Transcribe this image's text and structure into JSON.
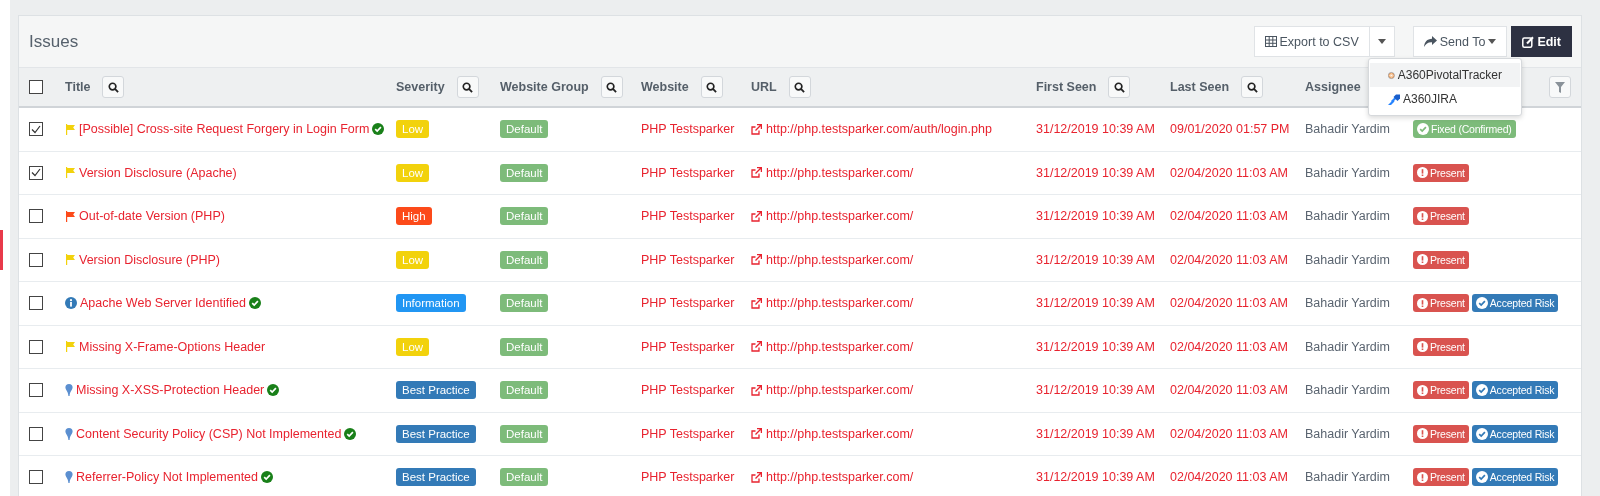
{
  "panel": {
    "title": "Issues"
  },
  "toolbar": {
    "export_label": "Export to CSV",
    "send_label": "Send To",
    "edit_label": "Edit"
  },
  "send_menu": [
    {
      "label": "A360PivotalTracker",
      "kind": "pivotal",
      "selected": true
    },
    {
      "label": "A360JIRA",
      "kind": "jira",
      "selected": false
    }
  ],
  "table": {
    "select_all": {
      "checked": false
    },
    "columns": [
      {
        "label": "Title",
        "searchable": true
      },
      {
        "label": "Severity",
        "searchable": true
      },
      {
        "label": "Website Group",
        "searchable": true
      },
      {
        "label": "Website",
        "searchable": true
      },
      {
        "label": "URL",
        "searchable": true
      },
      {
        "label": "First Seen",
        "searchable": true
      },
      {
        "label": "Last Seen",
        "searchable": true
      },
      {
        "label": "Assignee",
        "searchable": false
      }
    ],
    "rows": [
      {
        "checked": true,
        "kind": "flag",
        "title": "[Possible] Cross-site Request Forgery in Login Form",
        "verified": true,
        "severity": {
          "label": "Low",
          "color": "#f2d20c"
        },
        "group": "Default",
        "website": "PHP Testsparker",
        "url": "http://php.testsparker.com/auth/login.php",
        "first_seen": "31/12/2019 10:39 AM",
        "last_seen": "09/01/2020 01:57 PM",
        "assignee": "Bahadir Yardim",
        "statuses": [
          {
            "label": "Fixed (Confirmed)",
            "kind": "fixed"
          }
        ]
      },
      {
        "checked": true,
        "kind": "flag",
        "title": "Version Disclosure (Apache)",
        "verified": false,
        "severity": {
          "label": "Low",
          "color": "#f2d20c"
        },
        "group": "Default",
        "website": "PHP Testsparker",
        "url": "http://php.testsparker.com/",
        "first_seen": "31/12/2019 10:39 AM",
        "last_seen": "02/04/2020 11:03 AM",
        "assignee": "Bahadir Yardim",
        "statuses": [
          {
            "label": "Present",
            "kind": "present"
          }
        ]
      },
      {
        "checked": false,
        "kind": "flag",
        "title": "Out-of-date Version (PHP)",
        "verified": false,
        "severity": {
          "label": "High",
          "color": "#fc4a1a"
        },
        "group": "Default",
        "website": "PHP Testsparker",
        "url": "http://php.testsparker.com/",
        "first_seen": "31/12/2019 10:39 AM",
        "last_seen": "02/04/2020 11:03 AM",
        "assignee": "Bahadir Yardim",
        "statuses": [
          {
            "label": "Present",
            "kind": "present"
          }
        ]
      },
      {
        "checked": false,
        "kind": "flag",
        "title": "Version Disclosure (PHP)",
        "verified": false,
        "severity": {
          "label": "Low",
          "color": "#f2d20c"
        },
        "group": "Default",
        "website": "PHP Testsparker",
        "url": "http://php.testsparker.com/",
        "first_seen": "31/12/2019 10:39 AM",
        "last_seen": "02/04/2020 11:03 AM",
        "assignee": "Bahadir Yardim",
        "statuses": [
          {
            "label": "Present",
            "kind": "present"
          }
        ]
      },
      {
        "checked": false,
        "kind": "info",
        "title": "Apache Web Server Identified",
        "verified": true,
        "severity": {
          "label": "Information",
          "color": "#2196f3"
        },
        "group": "Default",
        "website": "PHP Testsparker",
        "url": "http://php.testsparker.com/",
        "first_seen": "31/12/2019 10:39 AM",
        "last_seen": "02/04/2020 11:03 AM",
        "assignee": "Bahadir Yardim",
        "statuses": [
          {
            "label": "Present",
            "kind": "present"
          },
          {
            "label": "Accepted Risk",
            "kind": "accepted"
          }
        ]
      },
      {
        "checked": false,
        "kind": "flag",
        "title": "Missing X-Frame-Options Header",
        "verified": false,
        "severity": {
          "label": "Low",
          "color": "#f2d20c"
        },
        "group": "Default",
        "website": "PHP Testsparker",
        "url": "http://php.testsparker.com/",
        "first_seen": "31/12/2019 10:39 AM",
        "last_seen": "02/04/2020 11:03 AM",
        "assignee": "Bahadir Yardim",
        "statuses": [
          {
            "label": "Present",
            "kind": "present"
          }
        ]
      },
      {
        "checked": false,
        "kind": "pin",
        "title": "Missing X-XSS-Protection Header",
        "verified": true,
        "severity": {
          "label": "Best Practice",
          "color": "#337ab7"
        },
        "group": "Default",
        "website": "PHP Testsparker",
        "url": "http://php.testsparker.com/",
        "first_seen": "31/12/2019 10:39 AM",
        "last_seen": "02/04/2020 11:03 AM",
        "assignee": "Bahadir Yardim",
        "statuses": [
          {
            "label": "Present",
            "kind": "present"
          },
          {
            "label": "Accepted Risk",
            "kind": "accepted"
          }
        ]
      },
      {
        "checked": false,
        "kind": "pin",
        "title": "Content Security Policy (CSP) Not Implemented",
        "verified": true,
        "severity": {
          "label": "Best Practice",
          "color": "#337ab7"
        },
        "group": "Default",
        "website": "PHP Testsparker",
        "url": "http://php.testsparker.com/",
        "first_seen": "31/12/2019 10:39 AM",
        "last_seen": "02/04/2020 11:03 AM",
        "assignee": "Bahadir Yardim",
        "statuses": [
          {
            "label": "Present",
            "kind": "present"
          },
          {
            "label": "Accepted Risk",
            "kind": "accepted"
          }
        ]
      },
      {
        "checked": false,
        "kind": "pin",
        "title": "Referrer-Policy Not Implemented",
        "verified": true,
        "severity": {
          "label": "Best Practice",
          "color": "#337ab7"
        },
        "group": "Default",
        "website": "PHP Testsparker",
        "url": "http://php.testsparker.com/",
        "first_seen": "31/12/2019 10:39 AM",
        "last_seen": "02/04/2020 11:03 AM",
        "assignee": "Bahadir Yardim",
        "statuses": [
          {
            "label": "Present",
            "kind": "present"
          },
          {
            "label": "Accepted Risk",
            "kind": "accepted"
          }
        ]
      }
    ]
  }
}
